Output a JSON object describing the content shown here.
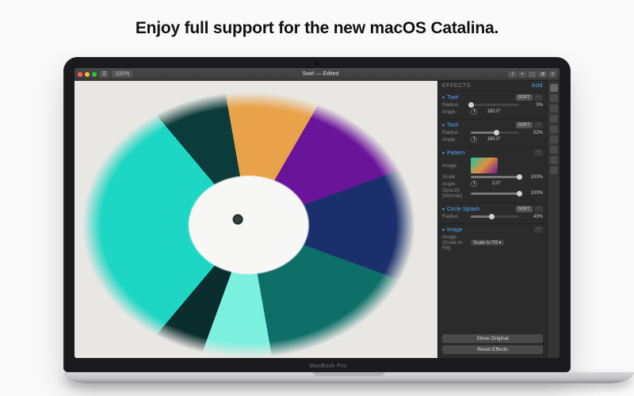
{
  "headline": "Enjoy full support for the new macOS Catalina.",
  "laptop_brand": "MacBook Pro",
  "traffic_colors": {
    "close": "#ff5f57",
    "min": "#febc2e",
    "max": "#28c840"
  },
  "titlebar": {
    "zoom": "100%",
    "doc_name": "Swirl",
    "doc_status": "Edited",
    "tools_right": [
      "⇪",
      "⌖",
      "⬚",
      "⊞",
      "≡"
    ]
  },
  "tools": [
    "▦",
    "↖",
    "◯",
    "⬚",
    "T",
    "✎",
    "◐",
    "⚙",
    "⊕"
  ],
  "panel": {
    "header": "EFFECTS",
    "add": "Add",
    "sections": [
      {
        "name": "Twirl",
        "tags": [
          "SOFT",
          "⋯"
        ],
        "params": [
          {
            "label": "Radius",
            "type": "slider",
            "value": "0%",
            "pct": 0
          },
          {
            "label": "Angle",
            "type": "dial",
            "value": "180.0°"
          }
        ]
      },
      {
        "name": "Twirl",
        "tags": [
          "SOFT",
          "⋯"
        ],
        "params": [
          {
            "label": "Radius",
            "type": "slider",
            "value": "52%",
            "pct": 52
          },
          {
            "label": "Angle",
            "type": "dial",
            "value": "180.0°"
          }
        ]
      },
      {
        "name": "Pattern",
        "tags": [
          "⋯"
        ],
        "params": [
          {
            "label": "Image",
            "type": "thumb"
          },
          {
            "label": "Scale",
            "type": "slider",
            "value": "100%",
            "pct": 100
          },
          {
            "label": "Angle",
            "type": "dial",
            "value": "0.0°"
          },
          {
            "label_full": "Opacity (Normal)",
            "label": "Opacity",
            "type": "slider",
            "value": "100%",
            "pct": 100
          }
        ]
      },
      {
        "name": "Circle Splash",
        "tags": [
          "SOFT",
          "⋯"
        ],
        "params": [
          {
            "label": "Radius",
            "type": "slider",
            "value": "43%",
            "pct": 43
          }
        ]
      },
      {
        "name": "Image",
        "tags": [
          "⋯"
        ],
        "params": [
          {
            "label_full": "Image (Scale to Fill)",
            "label": "Image",
            "type": "select",
            "value": "Scale to Fill"
          }
        ]
      }
    ],
    "footer": {
      "show_original": "Show Original",
      "reset": "Reset Effects"
    }
  }
}
